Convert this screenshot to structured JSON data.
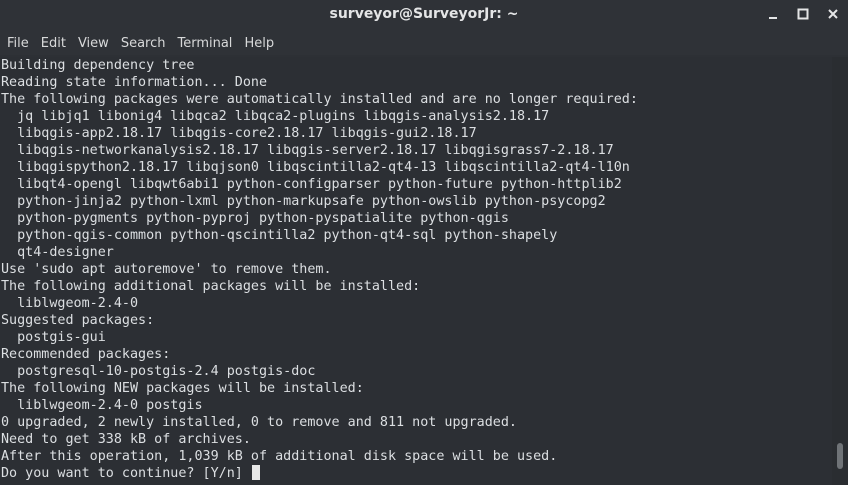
{
  "window": {
    "title": "surveyor@SurveyorJr: ~"
  },
  "menu": {
    "items": [
      {
        "label": "File"
      },
      {
        "label": "Edit"
      },
      {
        "label": "View"
      },
      {
        "label": "Search"
      },
      {
        "label": "Terminal"
      },
      {
        "label": "Help"
      }
    ]
  },
  "terminal": {
    "lines": [
      "Building dependency tree",
      "Reading state information... Done",
      "The following packages were automatically installed and are no longer required:",
      "  jq libjq1 libonig4 libqca2 libqca2-plugins libqgis-analysis2.18.17",
      "  libqgis-app2.18.17 libqgis-core2.18.17 libqgis-gui2.18.17",
      "  libqgis-networkanalysis2.18.17 libqgis-server2.18.17 libqgisgrass7-2.18.17",
      "  libqgispython2.18.17 libqjson0 libqscintilla2-qt4-13 libqscintilla2-qt4-l10n",
      "  libqt4-opengl libqwt6abi1 python-configparser python-future python-httplib2",
      "  python-jinja2 python-lxml python-markupsafe python-owslib python-psycopg2",
      "  python-pygments python-pyproj python-pyspatialite python-qgis",
      "  python-qgis-common python-qscintilla2 python-qt4-sql python-shapely",
      "  qt4-designer",
      "Use 'sudo apt autoremove' to remove them.",
      "The following additional packages will be installed:",
      "  liblwgeom-2.4-0",
      "Suggested packages:",
      "  postgis-gui",
      "Recommended packages:",
      "  postgresql-10-postgis-2.4 postgis-doc",
      "The following NEW packages will be installed:",
      "  liblwgeom-2.4-0 postgis",
      "0 upgraded, 2 newly installed, 0 to remove and 811 not upgraded.",
      "Need to get 338 kB of archives.",
      "After this operation, 1,039 kB of additional disk space will be used.",
      "Do you want to continue? [Y/n] "
    ]
  },
  "icons": {
    "minimize": "minimize-icon",
    "maximize": "maximize-icon",
    "close": "close-icon"
  },
  "scrollbar": {
    "position_fraction": 0.97
  },
  "colors": {
    "background": "#2c2f34",
    "text": "#dcdfe2",
    "titlebar": "#2f3237"
  }
}
